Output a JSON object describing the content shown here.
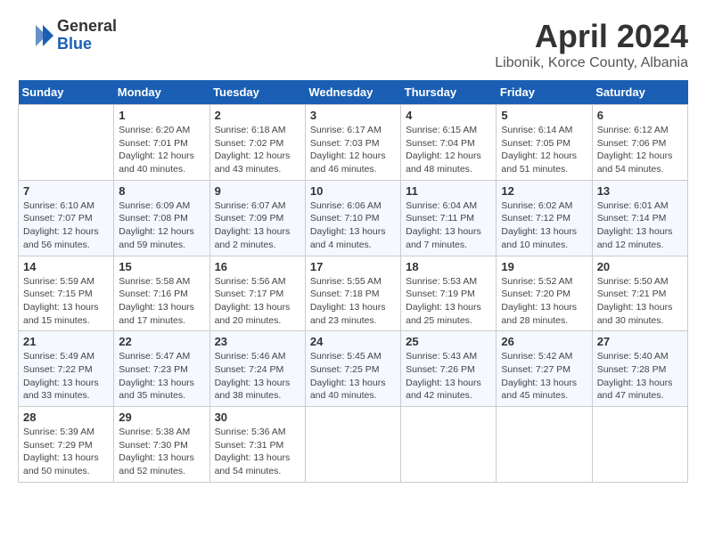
{
  "header": {
    "logo_general": "General",
    "logo_blue": "Blue",
    "month_year": "April 2024",
    "location": "Libonik, Korce County, Albania"
  },
  "columns": [
    "Sunday",
    "Monday",
    "Tuesday",
    "Wednesday",
    "Thursday",
    "Friday",
    "Saturday"
  ],
  "weeks": [
    [
      {
        "day": "",
        "info": ""
      },
      {
        "day": "1",
        "info": "Sunrise: 6:20 AM\nSunset: 7:01 PM\nDaylight: 12 hours\nand 40 minutes."
      },
      {
        "day": "2",
        "info": "Sunrise: 6:18 AM\nSunset: 7:02 PM\nDaylight: 12 hours\nand 43 minutes."
      },
      {
        "day": "3",
        "info": "Sunrise: 6:17 AM\nSunset: 7:03 PM\nDaylight: 12 hours\nand 46 minutes."
      },
      {
        "day": "4",
        "info": "Sunrise: 6:15 AM\nSunset: 7:04 PM\nDaylight: 12 hours\nand 48 minutes."
      },
      {
        "day": "5",
        "info": "Sunrise: 6:14 AM\nSunset: 7:05 PM\nDaylight: 12 hours\nand 51 minutes."
      },
      {
        "day": "6",
        "info": "Sunrise: 6:12 AM\nSunset: 7:06 PM\nDaylight: 12 hours\nand 54 minutes."
      }
    ],
    [
      {
        "day": "7",
        "info": "Sunrise: 6:10 AM\nSunset: 7:07 PM\nDaylight: 12 hours\nand 56 minutes."
      },
      {
        "day": "8",
        "info": "Sunrise: 6:09 AM\nSunset: 7:08 PM\nDaylight: 12 hours\nand 59 minutes."
      },
      {
        "day": "9",
        "info": "Sunrise: 6:07 AM\nSunset: 7:09 PM\nDaylight: 13 hours\nand 2 minutes."
      },
      {
        "day": "10",
        "info": "Sunrise: 6:06 AM\nSunset: 7:10 PM\nDaylight: 13 hours\nand 4 minutes."
      },
      {
        "day": "11",
        "info": "Sunrise: 6:04 AM\nSunset: 7:11 PM\nDaylight: 13 hours\nand 7 minutes."
      },
      {
        "day": "12",
        "info": "Sunrise: 6:02 AM\nSunset: 7:12 PM\nDaylight: 13 hours\nand 10 minutes."
      },
      {
        "day": "13",
        "info": "Sunrise: 6:01 AM\nSunset: 7:14 PM\nDaylight: 13 hours\nand 12 minutes."
      }
    ],
    [
      {
        "day": "14",
        "info": "Sunrise: 5:59 AM\nSunset: 7:15 PM\nDaylight: 13 hours\nand 15 minutes."
      },
      {
        "day": "15",
        "info": "Sunrise: 5:58 AM\nSunset: 7:16 PM\nDaylight: 13 hours\nand 17 minutes."
      },
      {
        "day": "16",
        "info": "Sunrise: 5:56 AM\nSunset: 7:17 PM\nDaylight: 13 hours\nand 20 minutes."
      },
      {
        "day": "17",
        "info": "Sunrise: 5:55 AM\nSunset: 7:18 PM\nDaylight: 13 hours\nand 23 minutes."
      },
      {
        "day": "18",
        "info": "Sunrise: 5:53 AM\nSunset: 7:19 PM\nDaylight: 13 hours\nand 25 minutes."
      },
      {
        "day": "19",
        "info": "Sunrise: 5:52 AM\nSunset: 7:20 PM\nDaylight: 13 hours\nand 28 minutes."
      },
      {
        "day": "20",
        "info": "Sunrise: 5:50 AM\nSunset: 7:21 PM\nDaylight: 13 hours\nand 30 minutes."
      }
    ],
    [
      {
        "day": "21",
        "info": "Sunrise: 5:49 AM\nSunset: 7:22 PM\nDaylight: 13 hours\nand 33 minutes."
      },
      {
        "day": "22",
        "info": "Sunrise: 5:47 AM\nSunset: 7:23 PM\nDaylight: 13 hours\nand 35 minutes."
      },
      {
        "day": "23",
        "info": "Sunrise: 5:46 AM\nSunset: 7:24 PM\nDaylight: 13 hours\nand 38 minutes."
      },
      {
        "day": "24",
        "info": "Sunrise: 5:45 AM\nSunset: 7:25 PM\nDaylight: 13 hours\nand 40 minutes."
      },
      {
        "day": "25",
        "info": "Sunrise: 5:43 AM\nSunset: 7:26 PM\nDaylight: 13 hours\nand 42 minutes."
      },
      {
        "day": "26",
        "info": "Sunrise: 5:42 AM\nSunset: 7:27 PM\nDaylight: 13 hours\nand 45 minutes."
      },
      {
        "day": "27",
        "info": "Sunrise: 5:40 AM\nSunset: 7:28 PM\nDaylight: 13 hours\nand 47 minutes."
      }
    ],
    [
      {
        "day": "28",
        "info": "Sunrise: 5:39 AM\nSunset: 7:29 PM\nDaylight: 13 hours\nand 50 minutes."
      },
      {
        "day": "29",
        "info": "Sunrise: 5:38 AM\nSunset: 7:30 PM\nDaylight: 13 hours\nand 52 minutes."
      },
      {
        "day": "30",
        "info": "Sunrise: 5:36 AM\nSunset: 7:31 PM\nDaylight: 13 hours\nand 54 minutes."
      },
      {
        "day": "",
        "info": ""
      },
      {
        "day": "",
        "info": ""
      },
      {
        "day": "",
        "info": ""
      },
      {
        "day": "",
        "info": ""
      }
    ]
  ]
}
